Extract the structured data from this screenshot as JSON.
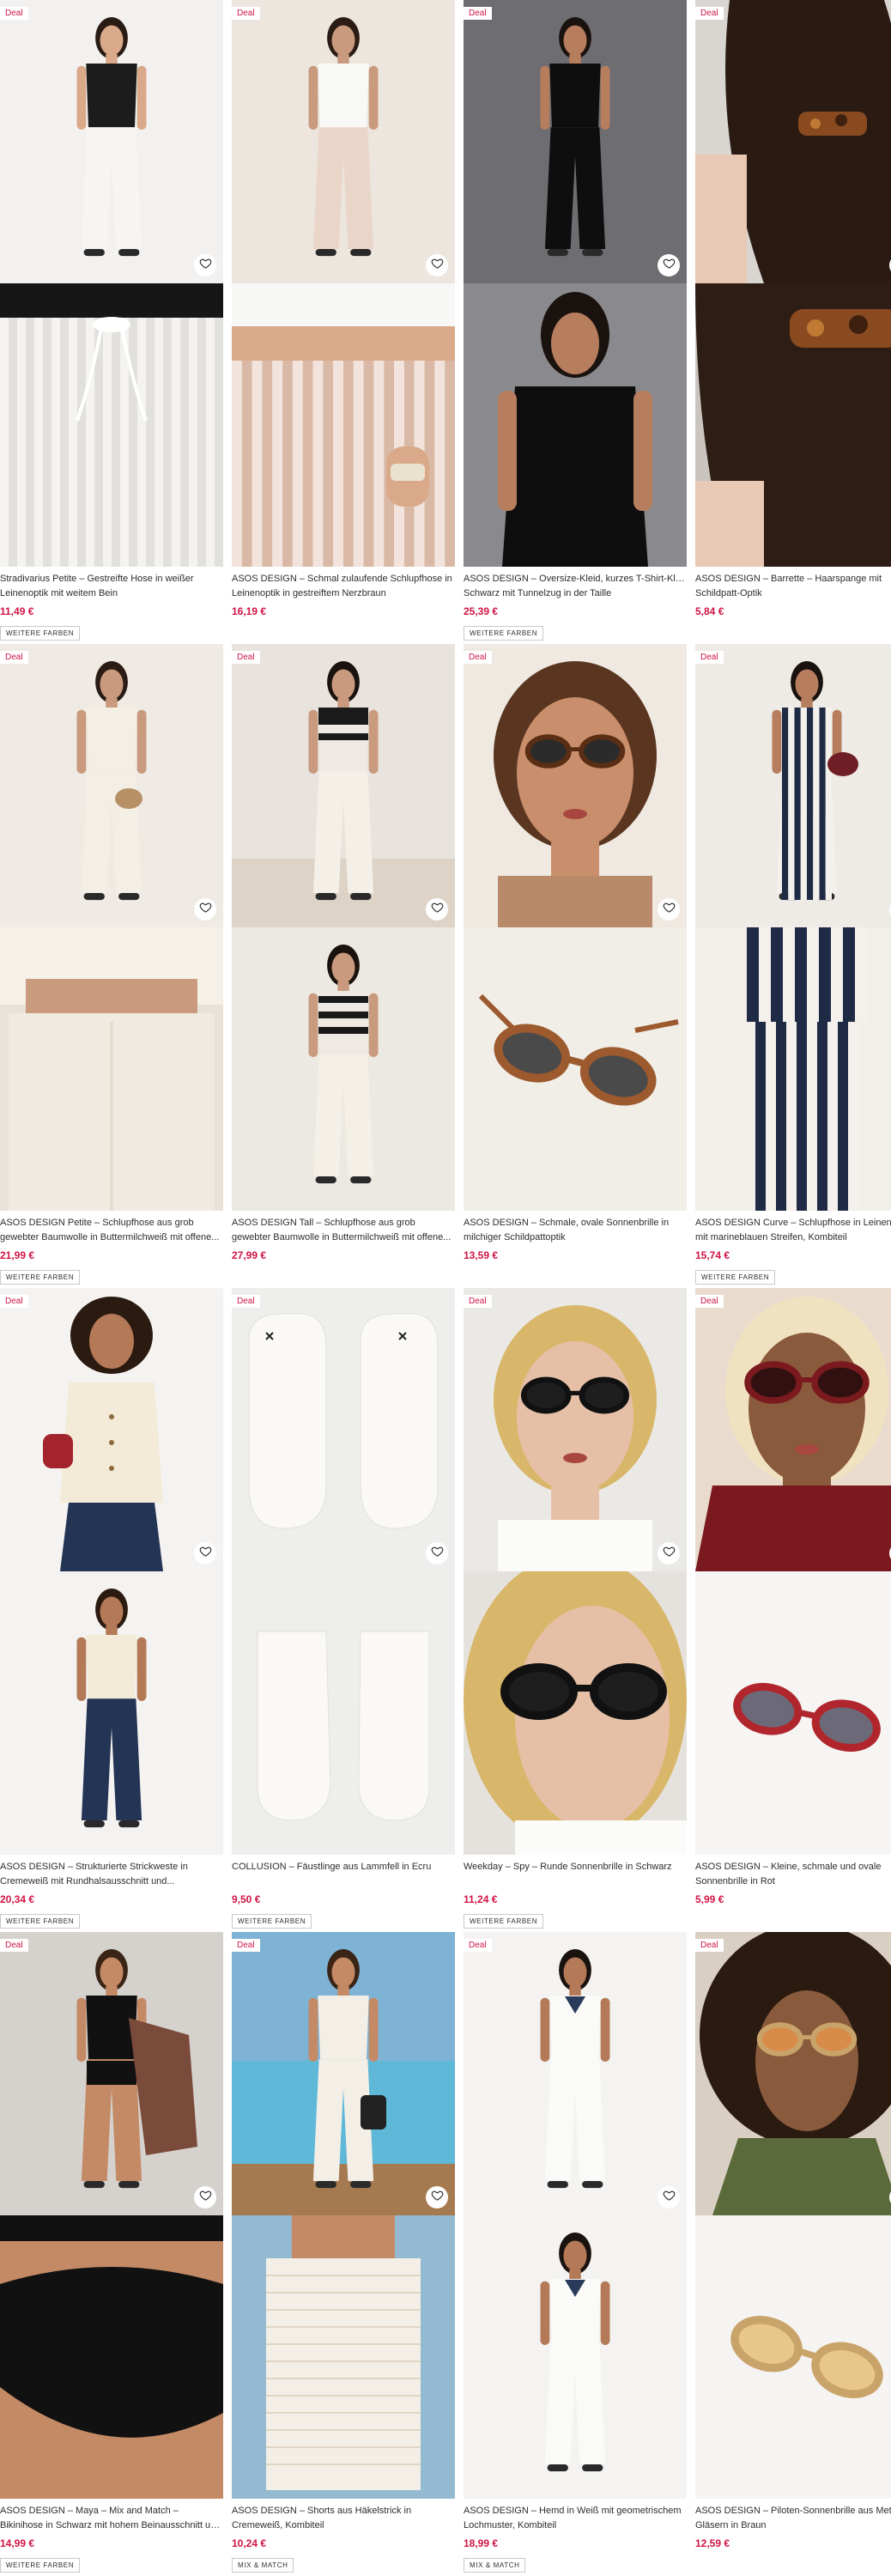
{
  "products": [
    {
      "badge": "Deal",
      "title_line1": "Stradivarius Petite – Gestreifte Hose in weißer",
      "title_line2": "Leinenoptik mit weitem Bein",
      "price": "11,49 €",
      "tag": "WEITERE FARBEN",
      "bg1": "#f3f1ef",
      "bg2": "#ebe8e4",
      "icon1": "woman-white-trousers-image",
      "icon2": "drawstring-closeup-image"
    },
    {
      "badge": "Deal",
      "title_line1": "ASOS DESIGN – Schmal zulaufende Schlupfhose in",
      "title_line2": "Leinenoptik in gestreiftem Nerzbraun",
      "price": "16,19 €",
      "tag": "",
      "bg1": "#ece6df",
      "bg2": "#f1ece6",
      "icon1": "woman-striped-trousers-image",
      "icon2": "striped-waistband-image"
    },
    {
      "badge": "Deal",
      "title_line1": "ASOS DESIGN – Oversize-Kleid, kurzes T-Shirt-Kleid in",
      "title_line2": "Schwarz mit Tunnelzug in der Taille",
      "price": "25,39 €",
      "tag": "WEITERE FARBEN",
      "bg1": "#6e6e72",
      "bg2": "#8a8a8e",
      "icon1": "woman-black-dress-image",
      "icon2": "black-dress-closeup-image"
    },
    {
      "badge": "Deal",
      "title_line1": "ASOS DESIGN – Barrette – Haarspange mit",
      "title_line2": "Schildpatt-Optik",
      "price": "5,84 €",
      "tag": "",
      "bg1": "#d9d6d1",
      "bg2": "#c9c4bd",
      "icon1": "hair-clip-image",
      "icon2": "hair-clip-closeup-image"
    },
    {
      "badge": "Deal",
      "title_line1": "ASOS DESIGN Petite – Schlupfhose aus grob",
      "title_line2": "gewebter Baumwolle in Buttermilchweiß mit offene...",
      "price": "21,99 €",
      "tag": "WEITERE FARBEN",
      "bg1": "#efeae3",
      "bg2": "#e9e2d8",
      "icon1": "woman-cream-set-image",
      "icon2": "cream-trousers-closeup-image"
    },
    {
      "badge": "Deal",
      "title_line1": "ASOS DESIGN Tall – Schlupfhose aus grob",
      "title_line2": "gewebter Baumwolle in Buttermilchweiß mit offene...",
      "price": "27,99 €",
      "tag": "",
      "bg1": "#e8e3dc",
      "bg2": "#ece8e2",
      "icon1": "woman-striped-top-image",
      "icon2": "woman-striped-top-walking-image"
    },
    {
      "badge": "Deal",
      "title_line1": "ASOS DESIGN – Schmale, ovale Sonnenbrille in",
      "title_line2": "milchiger Schildpattoptik",
      "price": "13,59 €",
      "tag": "",
      "bg1": "#b07a58",
      "bg2": "#f1ede7",
      "icon1": "woman-sunglasses-image",
      "icon2": "tortoiseshell-sunglasses-image"
    },
    {
      "badge": "Deal",
      "title_line1": "ASOS DESIGN Curve – Schlupfhose in Leinenoptik",
      "title_line2": "mit marineblauen Streifen, Kombiteil",
      "price": "15,74 €",
      "tag": "WEITERE FARBEN",
      "bg1": "#eeeae6",
      "bg2": "#f2efeb",
      "icon1": "woman-navy-stripes-image",
      "icon2": "navy-stripe-trousers-image"
    },
    {
      "badge": "Deal",
      "title_line1": "ASOS DESIGN – Strukturierte Strickweste in",
      "title_line2": "Cremeweiß mit Rundhalsausschnitt und...",
      "price": "20,34 €",
      "tag": "WEITERE FARBEN",
      "bg1": "#f5f3f1",
      "bg2": "#f5f3f1",
      "icon1": "woman-knit-vest-image",
      "icon2": "woman-knit-vest-full-image"
    },
    {
      "badge": "Deal",
      "title_line1": "COLLUSION – Fäustlinge aus Lammfell in Ecru",
      "title_line2": "",
      "price": "9,50 €",
      "tag": "WEITERE FARBEN",
      "bg1": "#eeeeed",
      "bg2": "#eeeeed",
      "icon1": "mittens-image",
      "icon2": "mittens-back-image"
    },
    {
      "badge": "Deal",
      "title_line1": "Weekday – Spy – Runde Sonnenbrille in Schwarz",
      "title_line2": "",
      "price": "11,24 €",
      "tag": "WEITERE FARBEN",
      "bg1": "#ebe9e6",
      "bg2": "#e5e2de",
      "icon1": "woman-black-sunglasses-image",
      "icon2": "black-sunglasses-closeup-image"
    },
    {
      "badge": "Deal",
      "title_line1": "ASOS DESIGN – Kleine, schmale und ovale",
      "title_line2": "Sonnenbrille in Rot",
      "price": "5,99 €",
      "tag": "",
      "bg1": "#c9b6a8",
      "bg2": "#f6f5f4",
      "icon1": "woman-red-sunglasses-image",
      "icon2": "red-sunglasses-image"
    },
    {
      "badge": "Deal",
      "title_line1": "ASOS DESIGN – Maya – Mix and Match –",
      "title_line2": "Bikinihose in Schwarz mit hohem Beinausschnitt un...",
      "price": "14,99 €",
      "tag": "WEITERE FARBEN",
      "bg1": "#d5d1cd",
      "bg2": "#c9bfb6",
      "icon1": "woman-black-bikini-image",
      "icon2": "bikini-bottom-closeup-image"
    },
    {
      "badge": "Deal",
      "title_line1": "ASOS DESIGN – Shorts aus Häkelstrick in",
      "title_line2": "Cremeweiß, Kombiteil",
      "price": "10,24 €",
      "tag": "MIX & MATCH",
      "bg1": "#7fb3d6",
      "bg2": "#93bad1",
      "icon1": "woman-crochet-set-pool-image",
      "icon2": "crochet-shorts-closeup-image"
    },
    {
      "badge": "Deal",
      "title_line1": "ASOS DESIGN – Hemd in Weiß mit geometrischem",
      "title_line2": "Lochmuster, Kombiteil",
      "price": "18,99 €",
      "tag": "MIX & MATCH",
      "bg1": "#f4f3f1",
      "bg2": "#f4f3f1",
      "icon1": "woman-white-shirt-image",
      "icon2": "woman-white-shirt-full-image"
    },
    {
      "badge": "Deal",
      "title_line1": "ASOS DESIGN – Piloten-Sonnenbrille aus Metall mit",
      "title_line2": "Gläsern in Braun",
      "price": "12,59 €",
      "tag": "",
      "bg1": "#7a6b52",
      "bg2": "#f6f4f2",
      "icon1": "woman-aviator-sunglasses-image",
      "icon2": "aviator-sunglasses-image"
    }
  ],
  "ui": {
    "save_icon": "heart-icon",
    "accent": "#d01345"
  }
}
